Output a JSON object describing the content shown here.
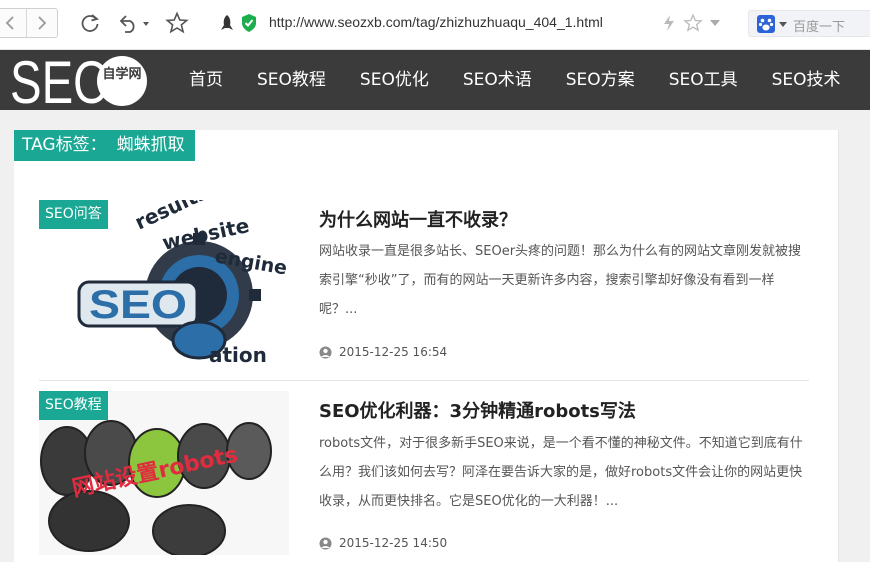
{
  "browser": {
    "url": "http://www.seozxb.com/tag/zhizhuzhuaqu_404_1.html",
    "search_placeholder": "百度一下"
  },
  "site": {
    "logo_text": "SEO",
    "logo_badge": "自学网",
    "nav": [
      "首页",
      "SEO教程",
      "SEO优化",
      "SEO术语",
      "SEO方案",
      "SEO工具",
      "SEO技术"
    ]
  },
  "tag": {
    "prefix": "TAG标签：",
    "keyword": "蜘蛛抓取"
  },
  "articles": [
    {
      "category": "SEO问答",
      "title": "为什么网站一直不收录？",
      "summary": "网站收录一直是很多站长、SEOer头疼的问题！那么为什么有的网站文章刚发就被搜索引擎“秒收”了，而有的网站一天更新许多内容，搜索引擎却好像没有看到一样呢？...",
      "date": "2015-12-25 16:54",
      "image_text": [
        "results",
        "website",
        "engine",
        "SEO",
        "ation"
      ]
    },
    {
      "category": "SEO教程",
      "title": "SEO优化利器：3分钟精通robots写法",
      "summary": "robots文件，对于很多新手SEO来说，是一个看不懂的神秘文件。不知道它到底有什么用？我们该如何去写？阿泽在要告诉大家的是，做好robots文件会让你的网站更快收录，从而更快排名。它是SEO优化的一大利器！...",
      "date": "2015-12-25 14:50",
      "image_text": "网站设置robots"
    }
  ],
  "colors": {
    "accent": "#1aa794",
    "header_bg": "#3b3b3b"
  }
}
